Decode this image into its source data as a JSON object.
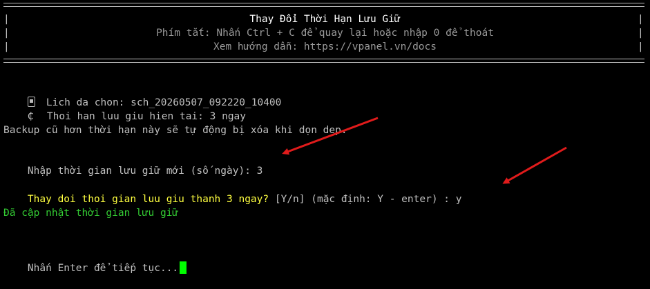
{
  "header": {
    "title": "Thay Đổi Thời Hạn Lưu Giữ",
    "shortcut_hint": "Phím tắt: Nhấn Ctrl + C để quay lại hoặc nhập 0 để thoát",
    "docs_hint": "Xem hướng dẫn: https://vpanel.vn/docs",
    "border_char": "|"
  },
  "info": {
    "selected_schedule": "Lich da chon: sch_20260507_092220_10400",
    "current_retention": "Thoi han luu giu hien tai: 3 ngay",
    "phone_icon": "phone-icon",
    "clock_icon": "clock-icon",
    "clock_glyph": "₵"
  },
  "notice": "Backup cũ hơn thời hạn này sẽ tự động bị xóa khi dọn dẹp.",
  "prompt_days": {
    "label": "Nhập thời gian lưu giữ mới (số ngày): ",
    "value": "3"
  },
  "confirm": {
    "question": "Thay doi thoi gian luu giu thanh 3 ngay?",
    "options": " [Y/n] (mặc định: Y - enter) : ",
    "answer": "y"
  },
  "success": "Đã cập nhật thời gian lưu giữ",
  "continue_prompt": "Nhấn Enter để tiếp tục...",
  "colors": {
    "background": "#000000",
    "text": "#c0c0c0",
    "title": "#ffffff",
    "dim": "#9a9a9a",
    "question": "#ffff40",
    "success": "#33cc33",
    "cursor": "#00ff00",
    "annotation_arrow": "#e01b1b"
  }
}
